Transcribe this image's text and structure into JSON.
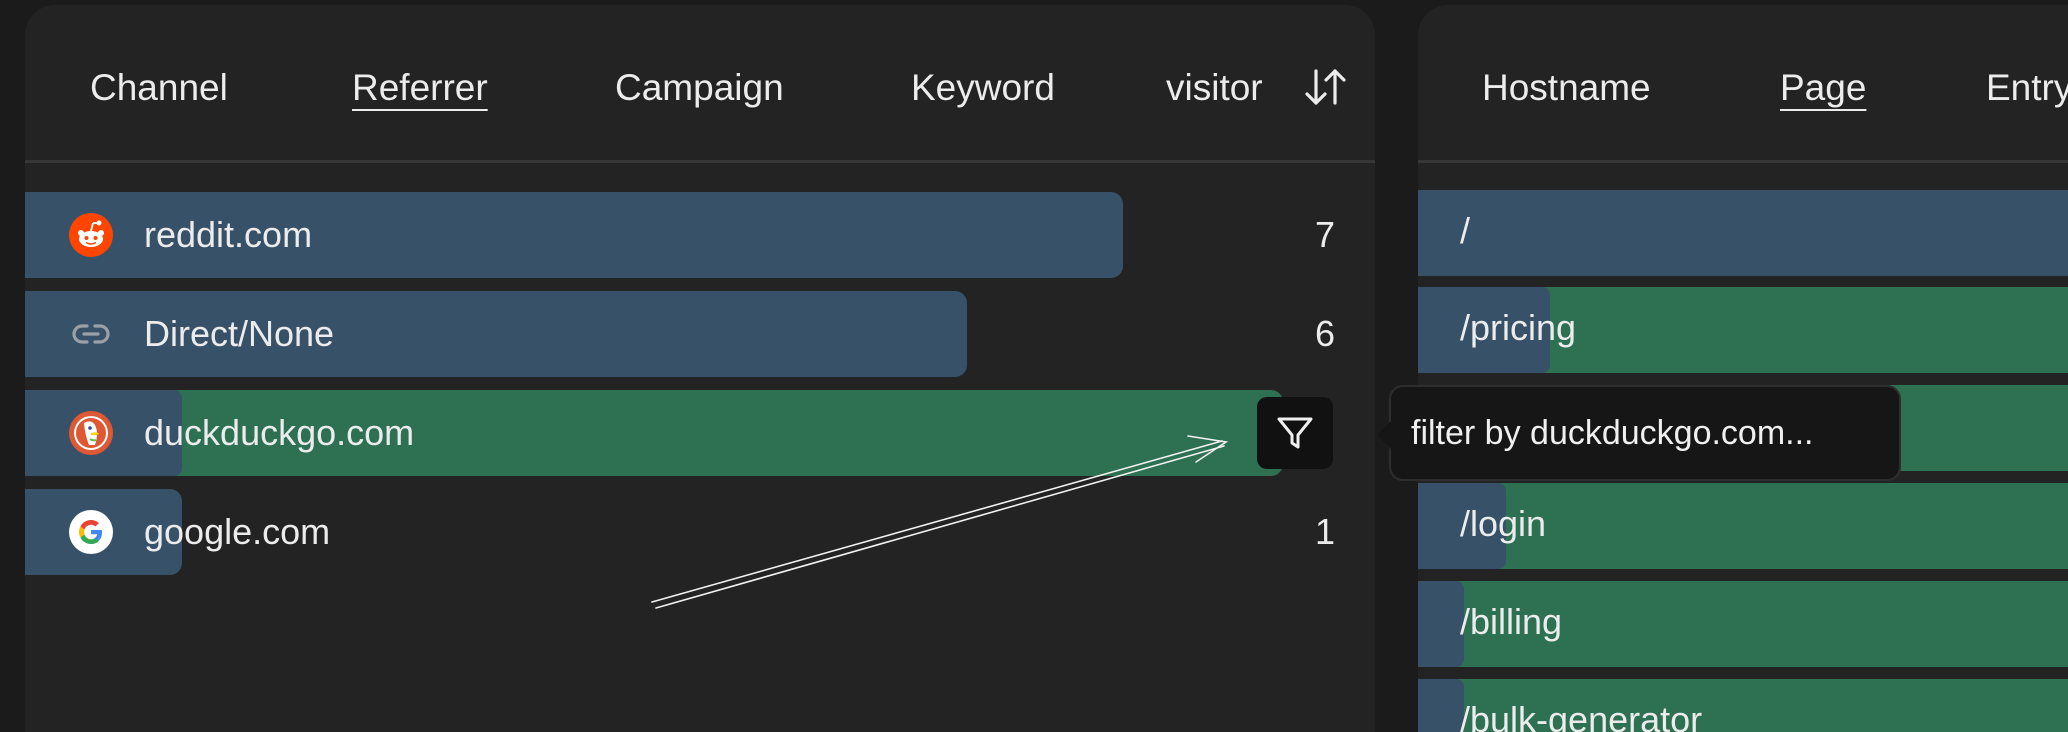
{
  "left_panel": {
    "tabs": [
      {
        "label": "Channel",
        "active": false
      },
      {
        "label": "Referrer",
        "active": true
      },
      {
        "label": "Campaign",
        "active": false
      },
      {
        "label": "Keyword",
        "active": false
      }
    ],
    "metric_label": "visitor",
    "rows": [
      {
        "label": "reddit.com",
        "count": "7",
        "icon": "reddit-icon"
      },
      {
        "label": "Direct/None",
        "count": "6",
        "icon": "link-icon"
      },
      {
        "label": "duckduckgo.com",
        "count": "",
        "icon": "duckduckgo-icon",
        "hovered": true
      },
      {
        "label": "google.com",
        "count": "1",
        "icon": "google-icon"
      }
    ],
    "tooltip": "filter by duckduckgo.com..."
  },
  "right_panel": {
    "tabs": [
      {
        "label": "Hostname",
        "active": false
      },
      {
        "label": "Page",
        "active": true
      },
      {
        "label": "Entry",
        "active": false
      }
    ],
    "rows": [
      {
        "label": "/"
      },
      {
        "label": "/pricing"
      },
      {
        "label": ""
      },
      {
        "label": "/login"
      },
      {
        "label": "/billing"
      },
      {
        "label": "/bulk-generator"
      }
    ]
  },
  "colors": {
    "bar_blue": "#375168",
    "bar_green": "#2d7052",
    "panel_bg": "#232323",
    "page_bg": "#1b1b1b"
  }
}
